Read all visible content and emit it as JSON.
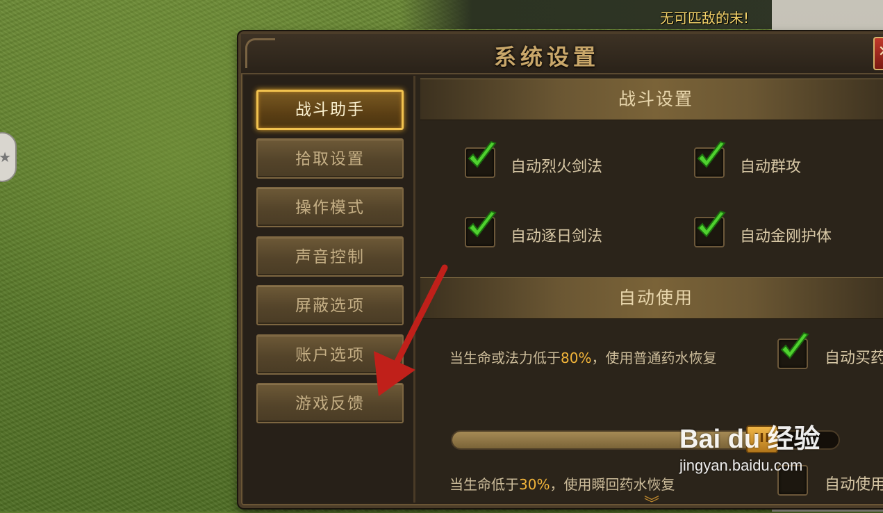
{
  "broadcast": "无可匹敌的末!",
  "dialog": {
    "title": "系统设置",
    "close_label": "✕"
  },
  "sidebar": {
    "items": [
      {
        "label": "战斗助手",
        "active": true
      },
      {
        "label": "拾取设置",
        "active": false
      },
      {
        "label": "操作模式",
        "active": false
      },
      {
        "label": "声音控制",
        "active": false
      },
      {
        "label": "屏蔽选项",
        "active": false
      },
      {
        "label": "账户选项",
        "active": false
      },
      {
        "label": "游戏反馈",
        "active": false
      }
    ]
  },
  "battle": {
    "header": "战斗设置",
    "options": [
      {
        "label": "自动烈火剑法",
        "checked": true
      },
      {
        "label": "自动群攻",
        "checked": true
      },
      {
        "label": "自动逐日剑法",
        "checked": true
      },
      {
        "label": "自动金刚护体",
        "checked": true
      }
    ]
  },
  "auto_use": {
    "header": "自动使用",
    "hp_mp_text_pre": "当生命或法力低于",
    "hp_mp_pct": "80%",
    "hp_mp_text_post": "，使用普通药水恢复",
    "auto_buy_label": "自动买药",
    "auto_buy_checked": true,
    "slider_value": 0.8,
    "slider_thumb_label": "III",
    "hp_text_pre": "当生命低于",
    "hp_pct": "30%",
    "hp_text_post": "，使用瞬回药水恢复",
    "auto_use_label": "自动使用",
    "auto_use_checked": false,
    "scroll_more": "︾"
  },
  "watermark": {
    "logo": "Bai du 经验",
    "url": "jingyan.baidu.com"
  },
  "colors": {
    "accent_gold": "#f1c24f",
    "pct_orange": "#f3b53a",
    "check_green": "#4fd12f",
    "annotation_arrow": "#c0201a"
  }
}
